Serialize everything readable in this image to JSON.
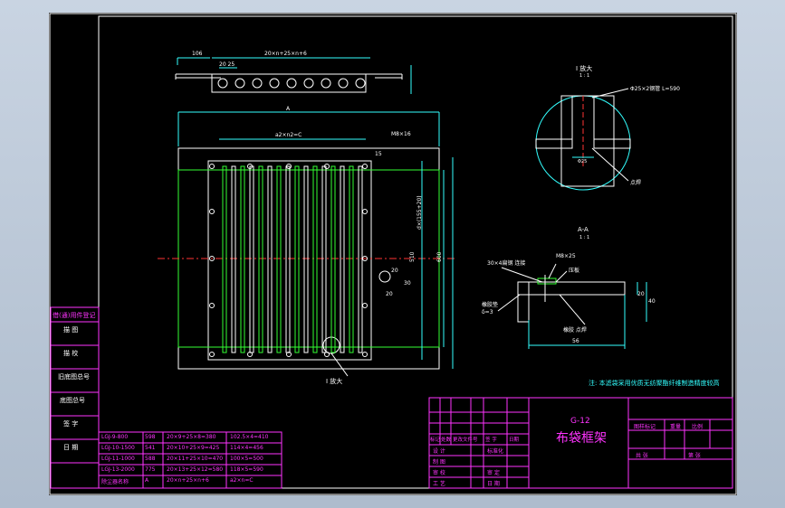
{
  "left_column": {
    "labels": [
      "借(通)用件登记",
      "描 图",
      "描 校",
      "旧底图总号",
      "底图总号",
      "签 字",
      "日 期"
    ]
  },
  "dimensions": {
    "top_view_overall": "20×n+25×n+6",
    "top_view_left": "106",
    "top_view_small": "20 25",
    "width_A": "A",
    "inner_span": "a2×n2=C",
    "bolt_note": "M8×16",
    "side_right": "15",
    "vertical_total": "d×(155+20)",
    "vertical_outer": "600",
    "vertical_inner": "510",
    "small_20a": "20",
    "small_30": "30",
    "small_20b": "20"
  },
  "detail_I": {
    "title": "I 放大",
    "scale": "1 : 1",
    "pipe": "Φ25×2钢管  L=590",
    "dia": "Φ25",
    "weld": "点焊"
  },
  "section_AA": {
    "title": "A-A",
    "scale": "1 : 1",
    "bar": "30×4扁钢 连接",
    "bolt": "M8×25",
    "nut": "压板",
    "gasket": "橡胶垫\nδ=3",
    "weld": "橡胶 点焊",
    "dim_20": "20",
    "dim_40": "40",
    "dim_56": "56"
  },
  "callout_I": "I 放大",
  "note": "注: 本滤袋采用优质无纺聚酯纤维制造精度较高",
  "parts_table": {
    "rows": [
      [
        "LGJ-9-800",
        "598",
        "20×9+25×8=380",
        "102.5×4=410"
      ],
      [
        "LGJ-10-1500",
        "541",
        "20×10+25×9=425",
        "114×4=456"
      ],
      [
        "LGJ-11-1000",
        "588",
        "20×11+25×10=470",
        "100×5=500"
      ],
      [
        "LGJ-13-2000",
        "775",
        "20×13+25×12=580",
        "118×5=590"
      ]
    ],
    "header": [
      "除尘器名称",
      "A",
      "20×n+25×n+6",
      "a2×n=C"
    ]
  },
  "title_block": {
    "drawing_no": "G-12",
    "drawing_name": "布袋框架",
    "revision_header": [
      "标记",
      "处数",
      "更改文件号",
      "签 字",
      "日期"
    ],
    "left_labels": [
      "设 计",
      "制 图",
      "审 校",
      "工 艺"
    ],
    "mid_labels": [
      "标准化",
      "",
      "审 定",
      "日 期"
    ],
    "right_header": [
      "图样标记",
      "重量",
      "比例"
    ],
    "right_footer": [
      "共  张",
      "第  张"
    ]
  },
  "colors": {
    "background": "#000000",
    "frame": "#ffffff",
    "table": "#ff33ff",
    "dimension": "#33ffff",
    "pipe": "#33ff33",
    "note": "#33ffff"
  }
}
